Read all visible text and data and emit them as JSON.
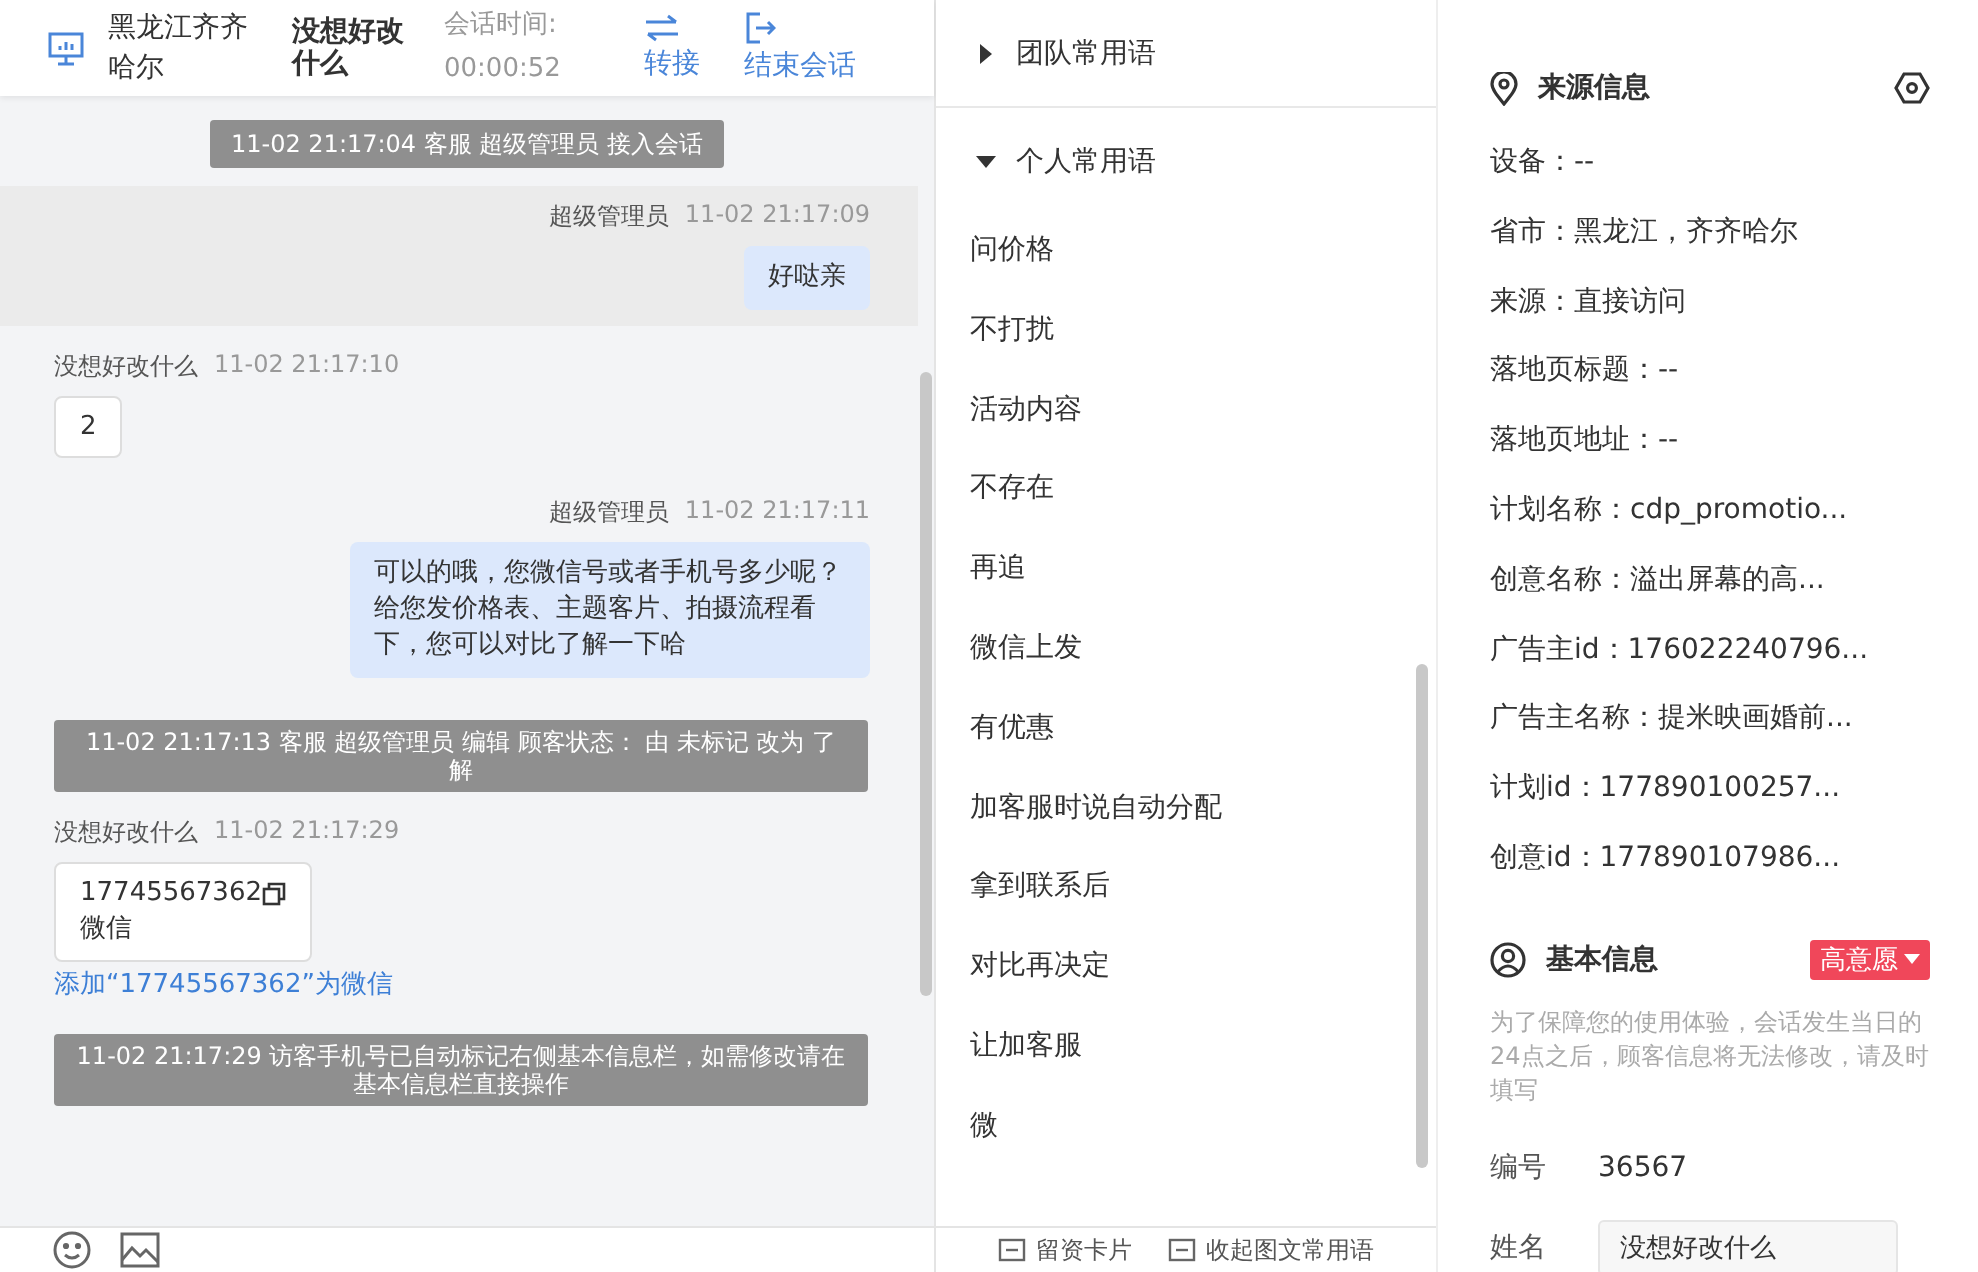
{
  "header": {
    "location": "黑龙江齐齐哈尔",
    "customer_name": "没想好改什么",
    "duration_label": "会话时间:",
    "duration": "00:00:52",
    "actions": [
      {
        "kind": "transfer",
        "label": "转接"
      },
      {
        "kind": "end",
        "label": "结束会话"
      }
    ]
  },
  "messages": [
    {
      "kind": "system",
      "text": "11-02 21:17:04 客服 超级管理员 接入会话"
    },
    {
      "kind": "agent",
      "name": "超级管理员",
      "time": "11-02 21:17:09",
      "text": "好哒亲",
      "highlighted": true
    },
    {
      "kind": "visitor",
      "name": "没想好改什么",
      "time": "11-02 21:17:10",
      "text": "2"
    },
    {
      "kind": "agent",
      "name": "超级管理员",
      "time": "11-02 21:17:11",
      "text": "可以的哦，您微信号或者手机号多少呢？给您发价格表、主题客片、拍摄流程看下，您可以对比了解一下哈",
      "highlighted": false
    },
    {
      "kind": "system",
      "text": "11-02 21:17:13 客服 超级管理员 编辑 顾客状态： 由 未标记 改为 了解"
    },
    {
      "kind": "contact",
      "name": "没想好改什么",
      "time": "11-02 21:17:29",
      "number": "17745567362",
      "type": "微信",
      "link": "添加“17745567362”为微信"
    },
    {
      "kind": "system",
      "text": "11-02 21:17:29 访客手机号已自动标记右侧基本信息栏，如需修改请在基本信息栏直接操作"
    }
  ],
  "quick_replies": {
    "groups": [
      {
        "title": "团队常用语",
        "expanded": false
      },
      {
        "title": "个人常用语",
        "expanded": true,
        "items": [
          "问价格",
          "不打扰",
          "活动内容",
          "不存在",
          "再追",
          "微信上发",
          "有优惠",
          "加客服时说自动分配",
          "拿到联系后",
          "对比再决定",
          "让加客服",
          "微"
        ]
      }
    ],
    "footer": [
      "留资卡片",
      "收起图文常用语"
    ]
  },
  "source_info": {
    "title": "来源信息",
    "lines": [
      "设备：--",
      "省市：黑龙江，齐齐哈尔",
      "来源：直接访问",
      "落地页标题：--",
      "落地页地址：--",
      "计划名称：cdp_promotio...",
      "创意名称：溢出屏幕的高...",
      "广告主id：176022240796...",
      "广告主名称：提米映画婚前...",
      "计划id：177890100257...",
      "创意id：177890107986..."
    ]
  },
  "basic_info": {
    "title": "基本信息",
    "intent_tag": "高意愿",
    "notice": "为了保障您的使用体验，会话发生当日的24点之后，顾客信息将无法修改，请及时填写",
    "fields": [
      {
        "kind": "text",
        "label": "编号",
        "value": "36567"
      },
      {
        "kind": "input",
        "label": "姓名",
        "value": "没想好改什么"
      }
    ]
  }
}
